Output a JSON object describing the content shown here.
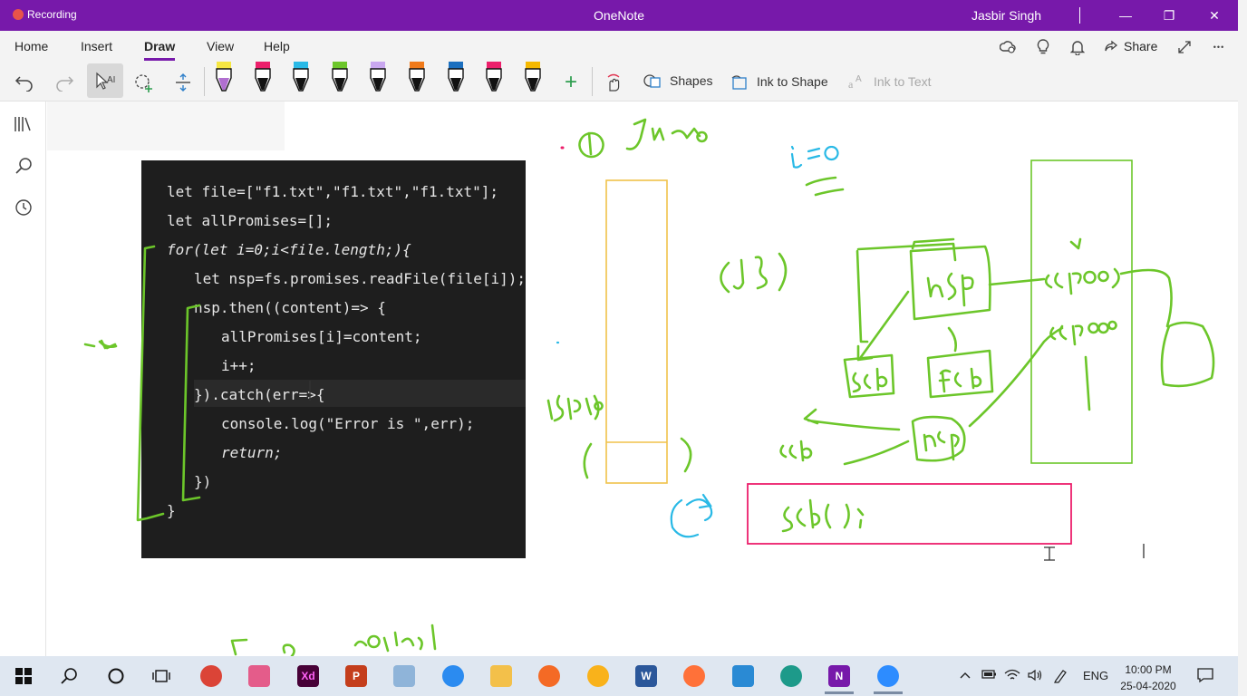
{
  "titlebar": {
    "recording_label": "Recording",
    "app_title": "OneNote",
    "user_name": "Jasbir Singh",
    "minimize_symbol": "—",
    "maximize_symbol": "❐",
    "close_symbol": "✕"
  },
  "menu": {
    "tabs": [
      {
        "label": "Home"
      },
      {
        "label": "Insert"
      },
      {
        "label": "Draw",
        "active": true
      },
      {
        "label": "View"
      },
      {
        "label": "Help"
      }
    ],
    "share_label": "Share",
    "more_symbol": "•••"
  },
  "ribbon": {
    "pens": [
      {
        "color": "#f5e642",
        "tip": "#b06fd0"
      },
      {
        "color": "#ec1f6b",
        "tip": "#111111"
      },
      {
        "color": "#29b9e6",
        "tip": "#111111"
      },
      {
        "color": "#6cc62a",
        "tip": "#111111"
      },
      {
        "color": "#c9a7ef",
        "tip": "#111111"
      },
      {
        "color": "#f07a1a",
        "tip": "#111111"
      },
      {
        "color": "#1b6fbf",
        "tip": "#111111"
      },
      {
        "color": "#ec1f6b",
        "tip": "#111111"
      },
      {
        "color": "#f5b800",
        "tip": "#111111"
      }
    ],
    "add_pen_symbol": "+",
    "shapes_label": "Shapes",
    "ink_to_shape_label": "Ink to Shape",
    "ink_to_text_label": "Ink to Text"
  },
  "code": {
    "lines": [
      "let file=[\"f1.txt\",\"f1.txt\",\"f1.txt\"];",
      "let allPromises=[];",
      "for(let i=0;i<file.length;){",
      "let nsp=fs.promises.readFile(file[i]);",
      "nsp.then((content)=> {",
      "allPromises[i]=content;",
      "i++;",
      "}).catch(err=>{",
      "console.log(\"Error is \",err);",
      "return;",
      "})",
      "}"
    ]
  },
  "taskbar": {
    "apps": [
      {
        "name": "chrome"
      },
      {
        "name": "snip"
      },
      {
        "name": "xd",
        "label": "Xd"
      },
      {
        "name": "powerpoint",
        "label": "P"
      },
      {
        "name": "notepad"
      },
      {
        "name": "firefox-dev"
      },
      {
        "name": "explorer"
      },
      {
        "name": "paint"
      },
      {
        "name": "sticky"
      },
      {
        "name": "word",
        "label": "W"
      },
      {
        "name": "firefox"
      },
      {
        "name": "vscode"
      },
      {
        "name": "edge"
      },
      {
        "name": "onenote",
        "label": "N"
      },
      {
        "name": "zoom"
      }
    ],
    "language": "ENG",
    "time": "10:00 PM",
    "date": "25-04-2020"
  }
}
